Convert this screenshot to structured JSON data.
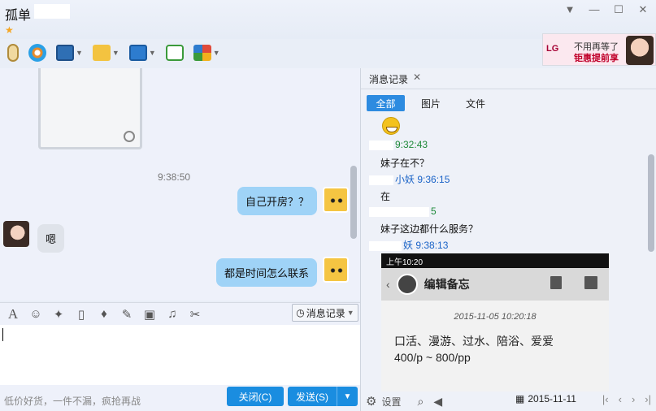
{
  "window": {
    "title": "孤单",
    "star": "★",
    "btn_dropdown": "▼",
    "btn_minimize": "—",
    "btn_maximize": "☐",
    "btn_close": "✕"
  },
  "toolbar": {
    "icons": [
      "microphone-icon",
      "camera-icon",
      "screen-share-icon",
      "folder-transfer-icon",
      "remote-desktop-icon",
      "add-app-icon",
      "app-grid-icon"
    ]
  },
  "ad": {
    "brand": "LG",
    "line1": "不用再等了",
    "line2": "钜惠提前享"
  },
  "chat": {
    "timestamp": "9:38:50",
    "messages": [
      {
        "side": "right",
        "text": "自己开房？？"
      },
      {
        "side": "left",
        "text": "嗯"
      },
      {
        "side": "right",
        "text": "都是时间怎么联系"
      }
    ]
  },
  "input": {
    "msg_record_label": "消息记录",
    "slogan": "低价好货，一件不漏，疯抢再战",
    "close_label": "关闭(C)",
    "send_label": "发送(S)"
  },
  "side": {
    "tab_label": "消息记录",
    "tab_close": "✕",
    "filters": {
      "all": "全部",
      "pics": "图片",
      "files": "文件"
    },
    "records": [
      {
        "type": "name",
        "color": "green",
        "name": "",
        "time": "9:32:43"
      },
      {
        "type": "text",
        "text": "妹子在不？"
      },
      {
        "type": "name",
        "color": "blue",
        "name": "小妖",
        "time": "9:36:15"
      },
      {
        "type": "text",
        "text": "在"
      },
      {
        "type": "name",
        "color": "green",
        "name": "",
        "time": "5"
      },
      {
        "type": "text",
        "text": "妹子这边都什么服务？"
      },
      {
        "type": "name",
        "color": "blue",
        "name": "妖",
        "time": "9:38:13"
      }
    ],
    "phone": {
      "status_time": "上午10:20",
      "title": "编辑备忘",
      "date": "2015-11-05 10:20:18",
      "body_line1": "口活、漫游、过水、陪浴、爱爱",
      "body_line2": "400/p ~ 800/pp"
    },
    "settings_label": "设置",
    "date": "2015-11-11"
  },
  "colors": {
    "accent": "#1a8de0",
    "bubble_right": "#9fd3f7",
    "bubble_left": "#dfe3ea"
  }
}
